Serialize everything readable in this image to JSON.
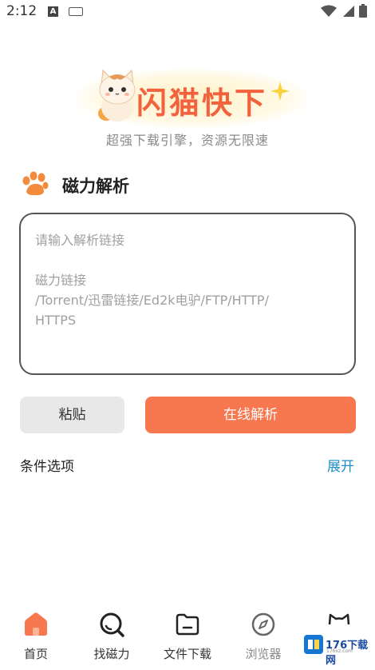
{
  "status_bar": {
    "time": "2:12",
    "icons": [
      "notification-a-icon",
      "keyboard-icon",
      "wifi-icon",
      "signal-icon",
      "battery-icon"
    ]
  },
  "logo": {
    "title": "闪猫快下",
    "subtitle": "超强下载引擎，资源无限速",
    "accent_color": "#f2623d"
  },
  "section": {
    "title": "磁力解析",
    "icon": "paw-icon"
  },
  "link_input": {
    "placeholder_line1": "请输入解析链接",
    "placeholder_line2": "磁力链接\n/Torrent/迅雷链接/Ed2k电驴/FTP/HTTP/\nHTTPS",
    "value": ""
  },
  "buttons": {
    "paste": "粘贴",
    "parse": "在线解析",
    "parse_color": "#f7774f"
  },
  "options": {
    "label": "条件选项",
    "expand": "展开"
  },
  "bottom_nav": {
    "items": [
      {
        "label": "首页",
        "icon": "home-icon"
      },
      {
        "label": "找磁力",
        "icon": "search-icon"
      },
      {
        "label": "文件下载",
        "icon": "folder-icon"
      },
      {
        "label": "浏览器",
        "icon": "compass-icon"
      },
      {
        "label": "",
        "icon": "cat-face-icon"
      }
    ]
  },
  "watermark": {
    "text": "176下载网",
    "sub": "176xz.com"
  }
}
